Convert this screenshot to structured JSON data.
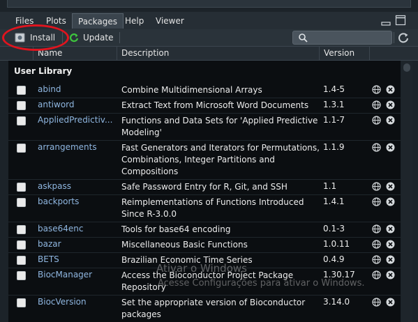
{
  "tabs": [
    "Files",
    "Plots",
    "Packages",
    "Help",
    "Viewer"
  ],
  "active_tab": "Packages",
  "toolbar": {
    "install_label": "Install",
    "update_label": "Update",
    "search_placeholder": ""
  },
  "columns": {
    "name": "Name",
    "description": "Description",
    "version": "Version"
  },
  "section_title": "User Library",
  "packages": [
    {
      "name": "abind",
      "desc": "Combine Multidimensional Arrays",
      "version": "1.4-5"
    },
    {
      "name": "antiword",
      "desc": "Extract Text from Microsoft Word Documents",
      "version": "1.3.1"
    },
    {
      "name": "AppliedPredictiv...",
      "desc": "Functions and Data Sets for 'Applied Predictive Modeling'",
      "version": "1.1-7"
    },
    {
      "name": "arrangements",
      "desc": "Fast Generators and Iterators for Permutations, Combinations, Integer Partitions and Compositions",
      "version": "1.1.9"
    },
    {
      "name": "askpass",
      "desc": "Safe Password Entry for R, Git, and SSH",
      "version": "1.1"
    },
    {
      "name": "backports",
      "desc": "Reimplementations of Functions Introduced Since R-3.0.0",
      "version": "1.4.1"
    },
    {
      "name": "base64enc",
      "desc": "Tools for base64 encoding",
      "version": "0.1-3"
    },
    {
      "name": "bazar",
      "desc": "Miscellaneous Basic Functions",
      "version": "1.0.11"
    },
    {
      "name": "BETS",
      "desc": "Brazilian Economic Time Series",
      "version": "0.4.9"
    },
    {
      "name": "BiocManager",
      "desc": "Access the Bioconductor Project Package Repository",
      "version": "1.30.17"
    },
    {
      "name": "BiocVersion",
      "desc": "Set the appropriate version of Bioconductor packages",
      "version": "3.14.0"
    }
  ],
  "watermark": {
    "line1": "Ativar o Windows",
    "line2": "Acesse Configurações para ativar o Windows."
  },
  "colors": {
    "highlight_ring": "#e0141e",
    "package_name": "#8fb6e0"
  }
}
